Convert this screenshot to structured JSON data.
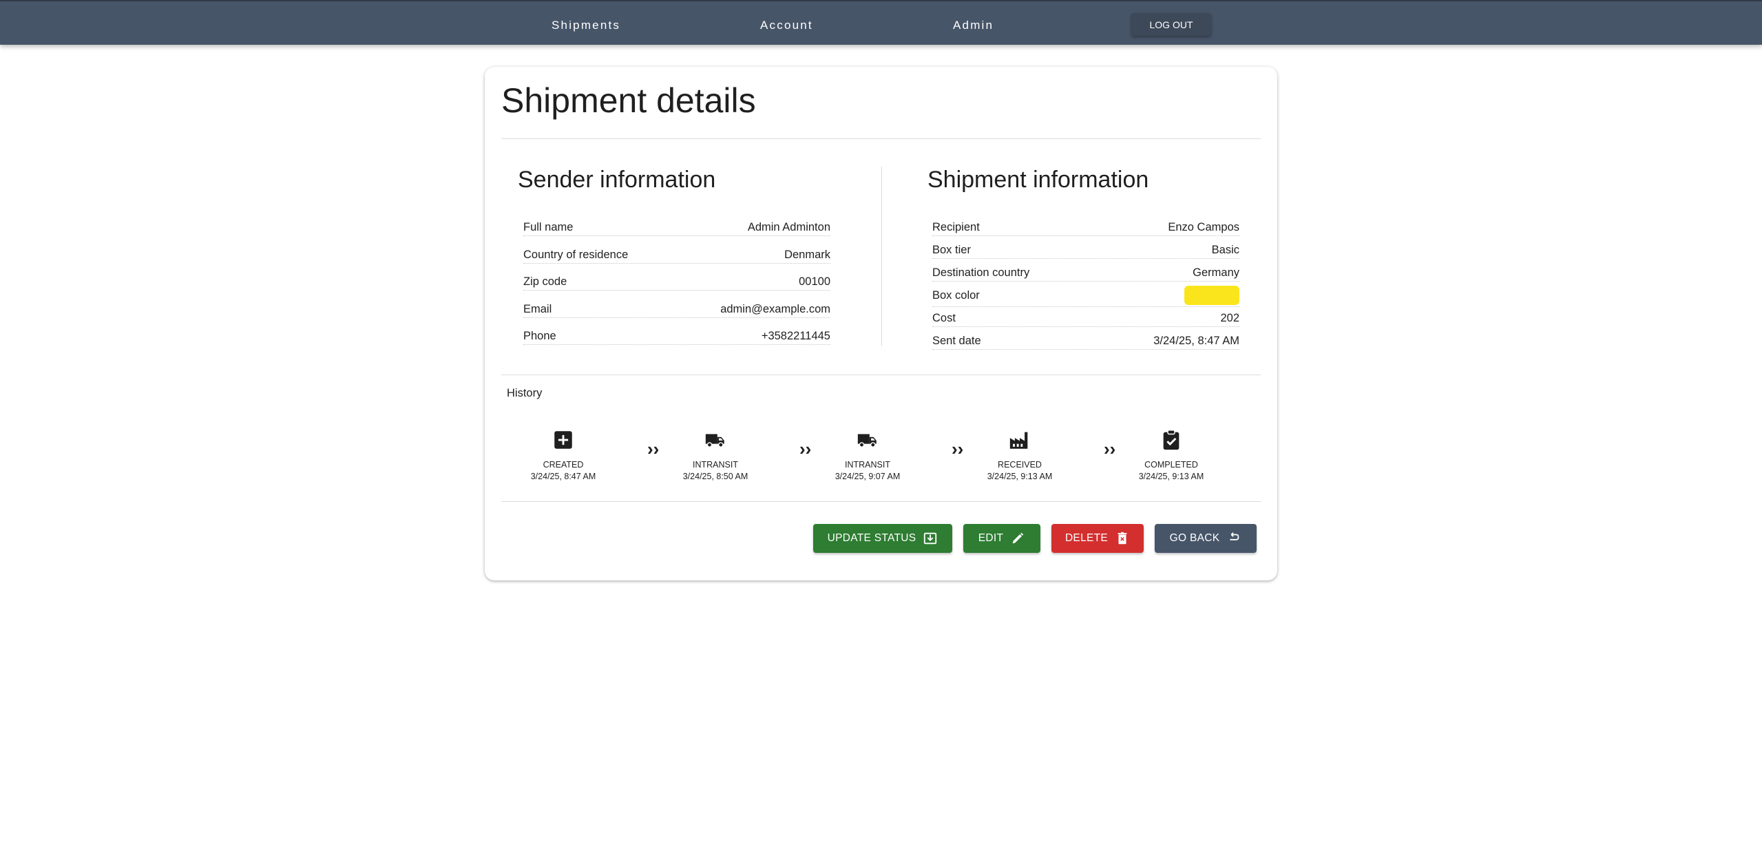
{
  "nav": {
    "shipments": "Shipments",
    "account": "Account",
    "admin": "Admin",
    "logout": "LOG OUT"
  },
  "page": {
    "title": "Shipment details"
  },
  "sender": {
    "title": "Sender information",
    "rows": [
      {
        "label": "Full name",
        "value": "Admin Adminton"
      },
      {
        "label": "Country of residence",
        "value": "Denmark"
      },
      {
        "label": "Zip code",
        "value": "00100"
      },
      {
        "label": "Email",
        "value": "admin@example.com"
      },
      {
        "label": "Phone",
        "value": "+3582211445"
      }
    ]
  },
  "shipment": {
    "title": "Shipment information",
    "rows": [
      {
        "label": "Recipient",
        "value": "Enzo Campos"
      },
      {
        "label": "Box tier",
        "value": "Basic"
      },
      {
        "label": "Destination country",
        "value": "Germany"
      },
      {
        "label": "Box color",
        "value": ""
      },
      {
        "label": "Cost",
        "value": "202"
      },
      {
        "label": "Sent date",
        "value": "3/24/25, 8:47 AM"
      }
    ],
    "box_color_hex": "#fae51c"
  },
  "history": {
    "label": "History",
    "separator": "››",
    "steps": [
      {
        "status": "CREATED",
        "date": "3/24/25, 8:47 AM",
        "icon": "plus-box-icon"
      },
      {
        "status": "INTRANSIT",
        "date": "3/24/25, 8:50 AM",
        "icon": "truck-icon"
      },
      {
        "status": "INTRANSIT",
        "date": "3/24/25, 9:07 AM",
        "icon": "truck-icon"
      },
      {
        "status": "RECEIVED",
        "date": "3/24/25, 9:13 AM",
        "icon": "factory-icon"
      },
      {
        "status": "COMPLETED",
        "date": "3/24/25, 9:13 AM",
        "icon": "clipboard-check-icon"
      }
    ]
  },
  "actions": {
    "update_status": "UPDATE STATUS",
    "edit": "EDIT",
    "delete": "DELETE",
    "go_back": "GO BACK"
  },
  "colors": {
    "navbar": "#475569",
    "green": "#2e7d32",
    "red": "#d32f2f",
    "slate": "#475569"
  }
}
